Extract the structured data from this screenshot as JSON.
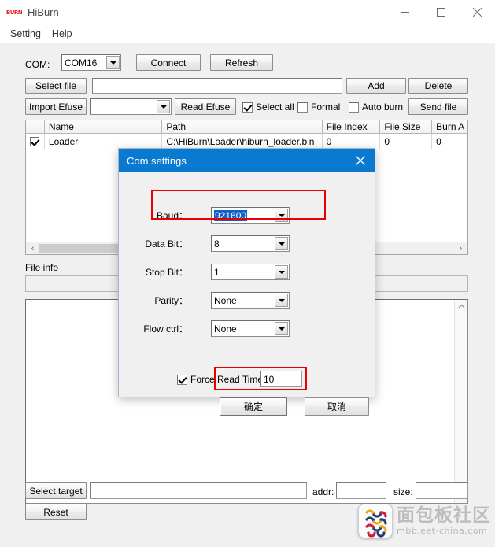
{
  "window": {
    "title": "HiBurn",
    "icon": "hiburn-logo-icon",
    "minimize": "minimize-icon",
    "maximize": "maximize-icon",
    "close": "close-icon"
  },
  "menubar": {
    "items": [
      {
        "label": "Setting"
      },
      {
        "label": "Help"
      }
    ]
  },
  "toolbar": {
    "com_label": "COM:",
    "com_value": "COM16",
    "connect_label": "Connect",
    "refresh_label": "Refresh",
    "select_file_label": "Select file",
    "select_file_value": "",
    "add_label": "Add",
    "delete_label": "Delete",
    "import_efuse_label": "Import Efuse",
    "import_efuse_value": "",
    "read_efuse_label": "Read Efuse",
    "select_all_label": "Select all",
    "select_all_checked": true,
    "formal_label": "Formal",
    "formal_checked": false,
    "auto_burn_label": "Auto burn",
    "auto_burn_checked": false,
    "send_file_label": "Send file"
  },
  "grid": {
    "columns": [
      "",
      "Name",
      "Path",
      "File Index",
      "File Size",
      "Burn A"
    ],
    "rows": [
      {
        "checked": true,
        "name": "Loader",
        "path": "C:\\HiBurn\\Loader\\hiburn_loader.bin",
        "file_index": "0",
        "file_size": "0",
        "burn_addr": "0"
      }
    ],
    "hscroll_left": "‹",
    "hscroll_right": "›"
  },
  "fileinfo": {
    "label": "File info",
    "value": ""
  },
  "log": {
    "value": "",
    "scroll_up": "⌃",
    "scroll_down": "⌄"
  },
  "bottom": {
    "select_target_label": "Select target",
    "select_target_value": "",
    "addr_label": "addr:",
    "addr_value": "",
    "size_label": "size:",
    "size_value": "",
    "reset_label": "Reset"
  },
  "dialog": {
    "title": "Com settings",
    "close": "close-icon",
    "baud_label": "Baud：",
    "baud_value": "921600",
    "data_bit_label": "Data Bit：",
    "data_bit_value": "8",
    "stop_bit_label": "Stop Bit：",
    "stop_bit_value": "1",
    "parity_label": "Parity：",
    "parity_value": "None",
    "flow_ctrl_label": "Flow ctrl：",
    "flow_ctrl_value": "None",
    "force_read_time_label": "Force Read Time",
    "force_read_time_checked": true,
    "force_read_time_value": "10",
    "ok_label": "确定",
    "cancel_label": "取消"
  },
  "annotations": {
    "highlight_color": "#e60000",
    "baud_highlight": "baud-field-highlight",
    "ok_highlight": "ok-button-highlight"
  },
  "watermark": {
    "text_cn": "面包板社区",
    "url": "mbb.eet-china.com"
  }
}
